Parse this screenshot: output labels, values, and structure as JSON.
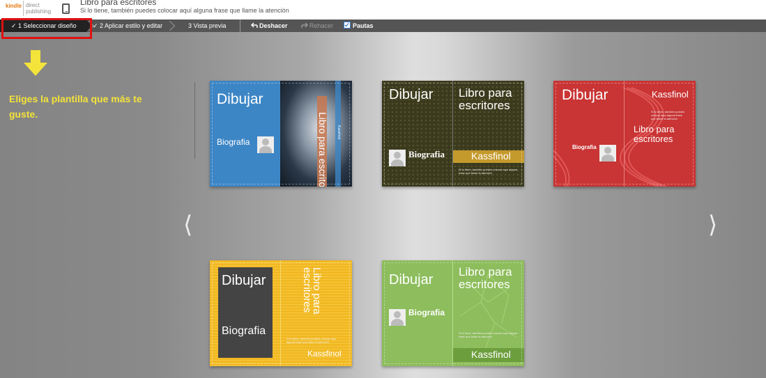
{
  "header": {
    "logo_kindle": "kindle",
    "logo_direct": "direct",
    "logo_publishing": "publishing",
    "book_title": "Libro para escritores",
    "book_subtitle": "Si lo tiene, también puedes colocar aquí alguna frase que llame la atención"
  },
  "toolbar": {
    "steps": [
      {
        "label": "✓ 1 Seleccionar diseño"
      },
      {
        "label": "✓ 2 Aplicar estilo y editar"
      },
      {
        "label": "3 Vista previa"
      }
    ],
    "undo_label": "Deshacer",
    "redo_label": "Rehacer",
    "guides_label": "Pautas"
  },
  "annotation": {
    "hint_text": "Eliges la plantilla que más te guste.",
    "arrow_color": "#f4e33a",
    "highlight_color": "#e01010"
  },
  "navigation": {
    "prev_glyph": "⟨",
    "next_glyph": "⟩"
  },
  "covers": [
    {
      "theme": "blue",
      "back_title": "Dibujar",
      "back_bio": "Biografia",
      "front_title": "Libro para escritores",
      "author": "Kassfinol",
      "color": "#3d86c6"
    },
    {
      "theme": "dark-olive",
      "back_title": "Dibujar",
      "back_bio": "Biografia",
      "front_title": "Libro para escritores",
      "author": "Kassfinol",
      "color": "#3b3a1e",
      "accent": "#c49a2c"
    },
    {
      "theme": "red",
      "back_title": "Dibujar",
      "back_bio": "Biografia",
      "front_title": "Libro para escritores",
      "author": "Kassfinol",
      "color": "#c93434"
    },
    {
      "theme": "yellow",
      "back_title": "Dibujar",
      "back_bio": "Biografia",
      "front_title": "Libro para escritores",
      "author": "Kassfinol",
      "color": "#f1b822",
      "panel": "#444444"
    },
    {
      "theme": "green",
      "back_title": "Dibujar",
      "back_bio": "Biografia",
      "front_title": "Libro para escritores",
      "author": "Kassfinol",
      "color": "#8dbd5c"
    }
  ]
}
